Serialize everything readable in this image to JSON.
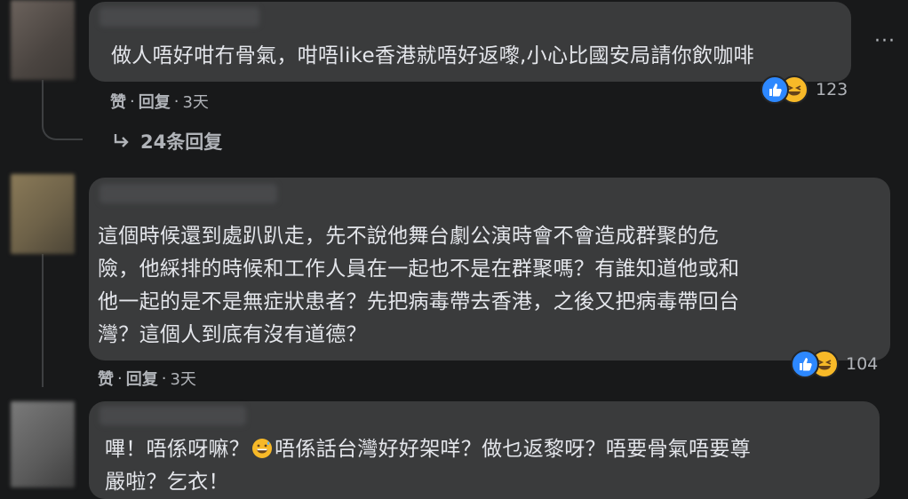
{
  "comments": [
    {
      "text": "做人唔好咁冇骨氣，咁唔like香港就唔好返嚟,小心比國安局請你飲咖啡",
      "actions": {
        "like": "赞",
        "reply": "回复",
        "sep": "·",
        "time": "3天"
      },
      "reactions": {
        "count": "123",
        "icons": [
          "like-icon",
          "haha-icon"
        ]
      },
      "replies_label": "24条回复"
    },
    {
      "text": "這個時候還到處趴趴走，先不說他舞台劇公演時會不會造成群聚的危\n險，他綵排的時候和工作人員在一起也不是在群聚嗎？有誰知道他或和\n他一起的是不是無症狀患者？先把病毒帶去香港，之後又把病毒帶回台\n灣？這個人到底有沒有道德？",
      "actions": {
        "like": "赞",
        "reply": "回复",
        "sep": "·",
        "time": "3天"
      },
      "reactions": {
        "count": "104",
        "icons": [
          "like-icon",
          "haha-icon"
        ]
      }
    },
    {
      "text_before_emoji": "嗶！唔係呀嘛？",
      "emoji": "grinning-sweat-emoji",
      "text_after_emoji": "唔係話台灣好好架咩？做乜返黎呀？唔要骨氣唔要尊\n嚴啦？乞衣！"
    }
  ],
  "menu": {
    "icon": "more-options-icon",
    "glyph": "···"
  },
  "colors": {
    "background": "#18191a",
    "bubble": "#3a3b3c",
    "text": "#e4e6eb",
    "secondary_text": "#b0b3b8",
    "like_blue": "#2d88ff",
    "haha_yellow": "#f7b928"
  }
}
